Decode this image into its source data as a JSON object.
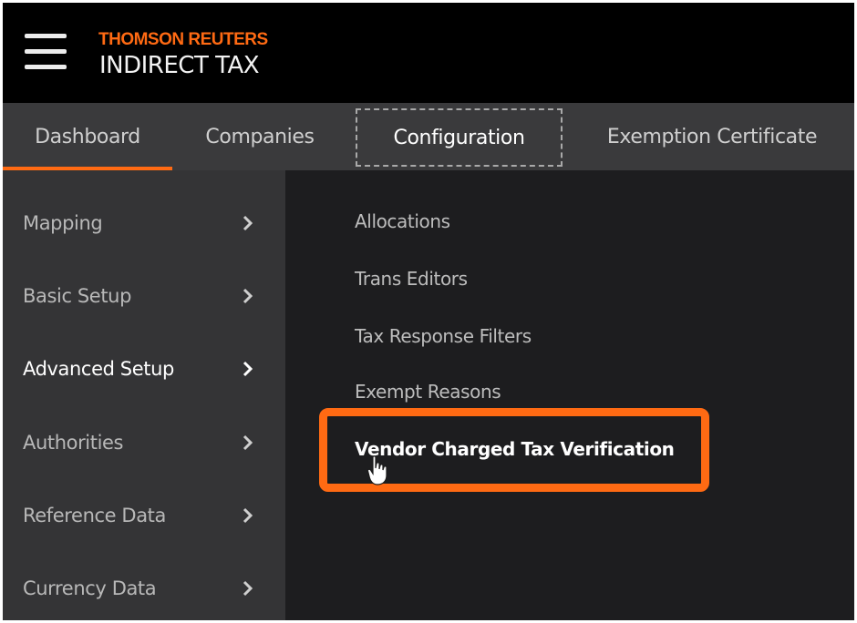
{
  "header": {
    "brand": "THOMSON REUTERS",
    "product": "INDIRECT TAX",
    "menu_icon": "hamburger-menu-icon"
  },
  "tabs": [
    {
      "label": "Dashboard"
    },
    {
      "label": "Companies"
    },
    {
      "label": "Configuration"
    },
    {
      "label": "Exemption Certificate"
    }
  ],
  "sidebar": {
    "items": [
      {
        "label": "Mapping"
      },
      {
        "label": "Basic Setup"
      },
      {
        "label": "Advanced Setup"
      },
      {
        "label": "Authorities"
      },
      {
        "label": "Reference Data"
      },
      {
        "label": "Currency Data"
      }
    ],
    "chevron_icon": "chevron-right-icon"
  },
  "submenu": {
    "items": [
      {
        "label": "Allocations"
      },
      {
        "label": "Trans Editors"
      },
      {
        "label": "Tax Response Filters"
      },
      {
        "label": "Exempt Reasons"
      },
      {
        "label": "Vendor Charged Tax Verification"
      }
    ]
  },
  "colors": {
    "accent": "#ff6a13",
    "header_bg": "#000000",
    "tabbar_bg": "#3a3a3c",
    "sidebar_bg": "#343436",
    "panel_bg": "#1d1d1f"
  }
}
